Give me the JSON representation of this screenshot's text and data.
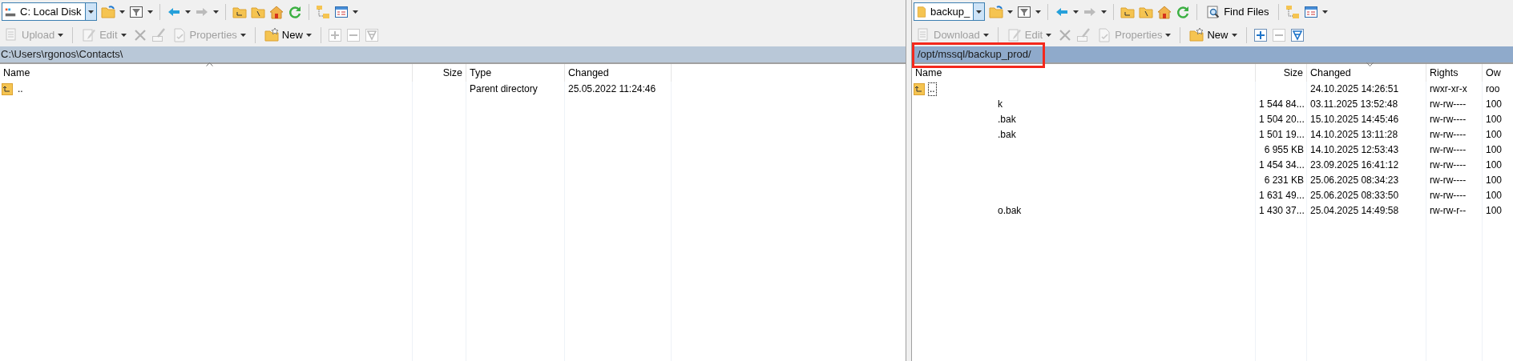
{
  "local_panel": {
    "drive": "C: Local Disk",
    "actions": [
      {
        "label": "Upload",
        "disabled": true
      },
      {
        "label": "Edit",
        "disabled": true
      },
      {
        "label": "Properties",
        "disabled": true
      },
      {
        "label": "New",
        "disabled": false
      }
    ],
    "mark_buttons": [
      {
        "disabled": true
      },
      {
        "disabled": true
      },
      {
        "disabled": true
      }
    ],
    "path": "C:\\Users\\rgonos\\Contacts\\",
    "active": false,
    "columns": [
      {
        "label": "Name",
        "sort_ascending": true
      },
      {
        "label": "Size"
      },
      {
        "label": "Type"
      },
      {
        "label": "Changed"
      }
    ],
    "rows": [
      {
        "kind": "parent",
        "name": "..",
        "type": "Parent directory",
        "changed": "25.05.2022 11:24:46",
        "focused": false
      }
    ]
  },
  "remote_panel": {
    "drive": "backup_",
    "find_button": "Find Files",
    "actions": [
      {
        "label": "Download",
        "disabled": true
      },
      {
        "label": "Edit",
        "disabled": true
      },
      {
        "label": "Properties",
        "disabled": true
      },
      {
        "label": "New",
        "disabled": false
      }
    ],
    "mark_buttons": [
      {
        "disabled": false
      },
      {
        "disabled": true
      },
      {
        "disabled": false
      }
    ],
    "path": "/opt/mssql/backup_prod/",
    "active": true,
    "columns": [
      {
        "label": "Name"
      },
      {
        "label": "Size"
      },
      {
        "label": "Changed",
        "sort_ascending": false
      },
      {
        "label": "Rights"
      },
      {
        "label": "Ow"
      }
    ],
    "rows": [
      {
        "kind": "parent",
        "name": "..",
        "changed": "24.10.2025 14:26:51",
        "rights": "rwxr-xr-x",
        "owner": "roo",
        "focused": true
      },
      {
        "kind": "file",
        "name": "k",
        "size": "1 544 84...",
        "changed": "03.11.2025 13:52:48",
        "rights": "rw-rw----",
        "owner": "100",
        "focused": false
      },
      {
        "kind": "file",
        "name": ".bak",
        "size": "1 504 20...",
        "changed": "15.10.2025 14:45:46",
        "rights": "rw-rw----",
        "owner": "100",
        "focused": false
      },
      {
        "kind": "file",
        "name": ".bak",
        "size": "1 501 19...",
        "changed": "14.10.2025 13:11:28",
        "rights": "rw-rw----",
        "owner": "100",
        "focused": false
      },
      {
        "kind": "file",
        "size": "6 955 KB",
        "changed": "14.10.2025 12:53:43",
        "rights": "rw-rw----",
        "owner": "100",
        "focused": false
      },
      {
        "kind": "file",
        "size": "1 454 34...",
        "changed": "23.09.2025 16:41:12",
        "rights": "rw-rw----",
        "owner": "100",
        "focused": false
      },
      {
        "kind": "file",
        "size": "6 231 KB",
        "changed": "25.06.2025 08:34:23",
        "rights": "rw-rw----",
        "owner": "100",
        "focused": false
      },
      {
        "kind": "file",
        "size": "1 631 49...",
        "changed": "25.06.2025 08:33:50",
        "rights": "rw-rw----",
        "owner": "100",
        "focused": false
      },
      {
        "kind": "file",
        "name": "o.bak",
        "size": "1 430 37...",
        "changed": "25.04.2025 14:49:58",
        "rights": "rw-rw-r--",
        "owner": "100",
        "focused": false
      }
    ]
  }
}
